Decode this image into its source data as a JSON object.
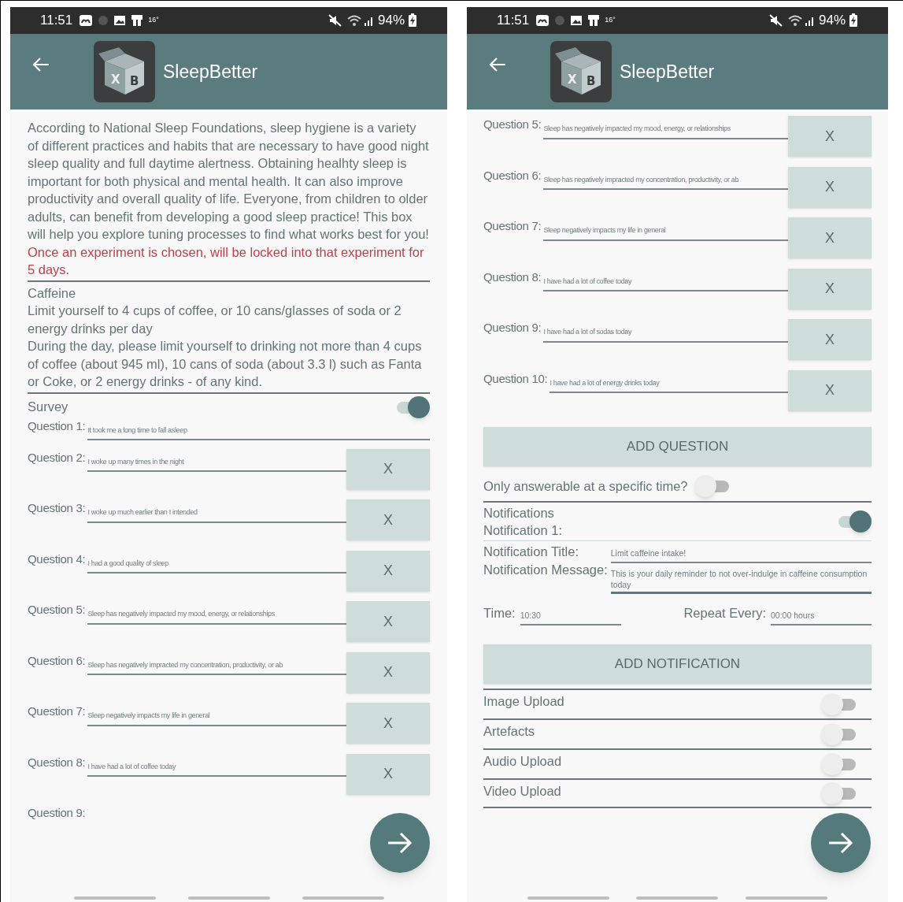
{
  "phones": [
    {
      "status_bar": {
        "time": "11:51",
        "weather": "16°",
        "battery": "94%"
      },
      "app_bar": {
        "title": "SleepBetter",
        "logo_marks": [
          "X",
          "B"
        ]
      },
      "blocks": [
        {
          "kind": "intro",
          "text": "According to National Sleep Foundations, sleep hygiene is a variety of different practices and habits that are necessary to have good night sleep quality and full daytime alertness. Obtaining healhty sleep is important for both physical and mental health. It can also improve productivity and overall quality of life. Everyone, from children to older adults, can benefit from developing a good sleep practice! This box will help you explore tuning processes to find what works best for you!",
          "warning": "Once an experiment is chosen, will be locked into that experiment for 5 days."
        },
        {
          "kind": "experiment",
          "title": "Caffeine",
          "summary": "Limit yourself to 4 cups of coffee, or 10 cans/glasses of soda or 2 energy drinks per day",
          "details": "During the day, please limit yourself to drinking not more than 4 cups of coffee (about 945 ml), 10 cans of soda (about 3.3 l) such as Fanta or Coke, or 2 energy drinks - of any kind."
        },
        {
          "kind": "section",
          "label": "Survey",
          "on": true
        },
        {
          "kind": "question",
          "label": "Question 1:",
          "value": "It took me a long time to fall asleep",
          "removable": false
        },
        {
          "kind": "question",
          "label": "Question 2:",
          "value": "I woke up many times in the night",
          "removable": true,
          "remove": "X"
        },
        {
          "kind": "question",
          "label": "Question 3:",
          "value": "I woke up much earlier than I intended",
          "removable": true,
          "remove": "X"
        },
        {
          "kind": "question",
          "label": "Question 4:",
          "value": "I had a good quality of sleep",
          "removable": true,
          "remove": "X"
        },
        {
          "kind": "question",
          "label": "Question 5:",
          "value": "Sleep has negatively impacted my mood, energy, or relationships",
          "removable": true,
          "remove": "X"
        },
        {
          "kind": "question",
          "label": "Question 6:",
          "value": "Sleep has negatively impracted my concentration, productivity, or ab",
          "removable": true,
          "remove": "X"
        },
        {
          "kind": "question",
          "label": "Question 7:",
          "value": "Sleep negatively impacts my life in general",
          "removable": true,
          "remove": "X"
        },
        {
          "kind": "question",
          "label": "Question 8:",
          "value": "I have had a lot of coffee today",
          "removable": true,
          "remove": "X"
        },
        {
          "kind": "question",
          "label": "Question 9:",
          "removable": false
        }
      ]
    },
    {
      "status_bar": {
        "time": "11:51",
        "weather": "16°",
        "battery": "94%"
      },
      "app_bar": {
        "title": "SleepBetter",
        "logo_marks": [
          "X",
          "B"
        ]
      },
      "blocks": [
        {
          "kind": "question",
          "label": "Question 5:",
          "value": "Sleep has negatively impacted my mood, energy, or relationships",
          "removable": true,
          "remove": "X"
        },
        {
          "kind": "question",
          "label": "Question 6:",
          "value": "Sleep has negatively impracted my concentration, productivity, or ab",
          "removable": true,
          "remove": "X"
        },
        {
          "kind": "question",
          "label": "Question 7:",
          "value": "Sleep negatively impacts my life in general",
          "removable": true,
          "remove": "X"
        },
        {
          "kind": "question",
          "label": "Question 8:",
          "value": "I have had a lot of coffee today",
          "removable": true,
          "remove": "X"
        },
        {
          "kind": "question",
          "label": "Question 9:",
          "value": "I have had a lot of sodas today",
          "removable": true,
          "remove": "X"
        },
        {
          "kind": "question",
          "label": "Question 10:",
          "value": "I have had a lot of energy drinks today",
          "removable": true,
          "remove": "X"
        },
        {
          "kind": "button",
          "label": "ADD QUESTION"
        },
        {
          "kind": "inline_toggle",
          "label": "Only answerable at a specific time?",
          "on": false
        },
        {
          "kind": "notifications",
          "label": "Notifications",
          "on": true,
          "item_label": "Notification 1:",
          "title_label": "Notification Title:",
          "title_value": "Limit caffeine intake!",
          "message_label": "Notification Message:",
          "message_value": "This is your daily reminder to not over-indulge in caffeine consumption today",
          "time_label": "Time:",
          "time_value": "10:30",
          "repeat_label": "Repeat Every:",
          "repeat_value": "00:00 hours"
        },
        {
          "kind": "button",
          "label": "ADD NOTIFICATION"
        },
        {
          "kind": "toggle_row",
          "label": "Image Upload",
          "on": false
        },
        {
          "kind": "toggle_row",
          "label": "Artefacts",
          "on": false
        },
        {
          "kind": "toggle_row",
          "label": "Audio Upload",
          "on": false
        },
        {
          "kind": "toggle_row",
          "label": "Video Upload",
          "on": false
        }
      ]
    }
  ]
}
